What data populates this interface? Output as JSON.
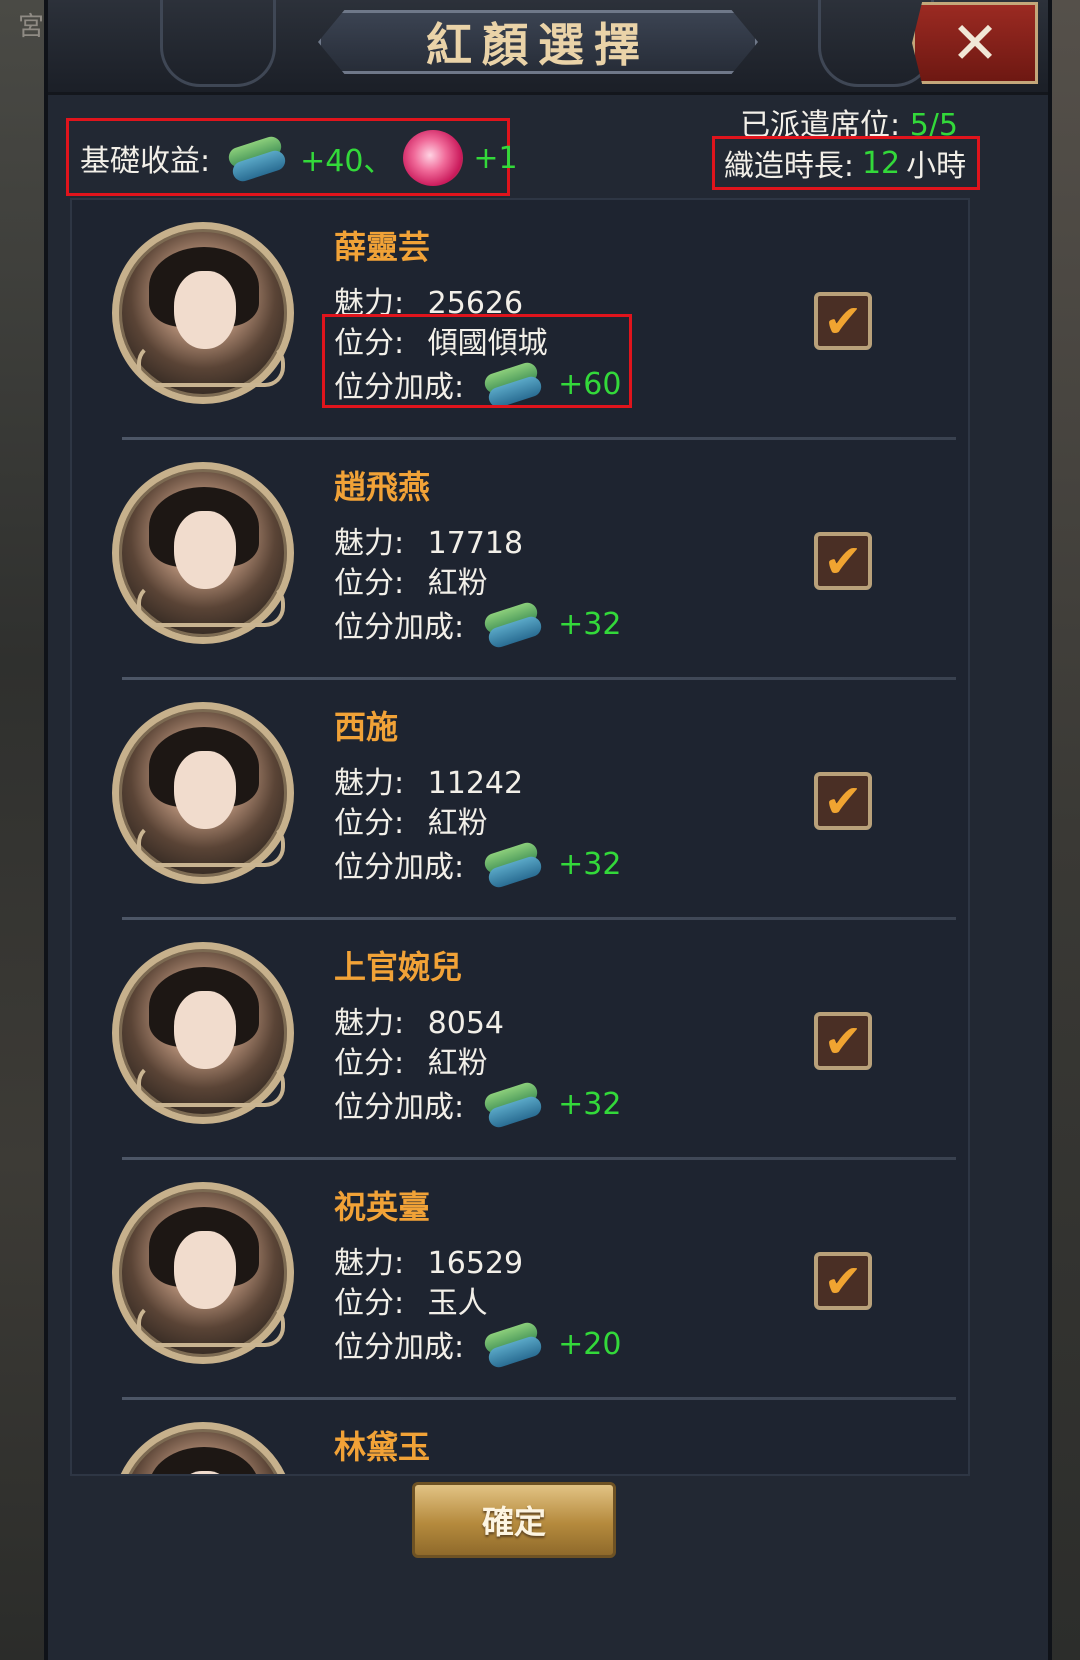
{
  "header": {
    "title": "紅顏選擇"
  },
  "background": {
    "edge_text": "宮"
  },
  "summary": {
    "base_income_label": "基礎收益:",
    "base_income_silk": "+40、",
    "base_income_flower": "+1",
    "dispatch_label": "已派遣席位:",
    "dispatch_value": "5/5",
    "duration_label": "織造時長:",
    "duration_value": "12",
    "duration_unit": "小時"
  },
  "labels": {
    "charm": "魅力:",
    "rank": "位分:",
    "rank_bonus": "位分加成:"
  },
  "consorts": [
    {
      "name": "薛靈芸",
      "charm": "25626",
      "rank": "傾國傾城",
      "bonus": "+60",
      "checked": true
    },
    {
      "name": "趙飛燕",
      "charm": "17718",
      "rank": "紅粉",
      "bonus": "+32",
      "checked": true
    },
    {
      "name": "西施",
      "charm": "11242",
      "rank": "紅粉",
      "bonus": "+32",
      "checked": true
    },
    {
      "name": "上官婉兒",
      "charm": "8054",
      "rank": "紅粉",
      "bonus": "+32",
      "checked": true
    },
    {
      "name": "祝英臺",
      "charm": "16529",
      "rank": "玉人",
      "bonus": "+20",
      "checked": true
    },
    {
      "name": "林黛玉"
    }
  ],
  "checkmark": "✔",
  "confirm_label": "確定",
  "icons": {
    "close": "close-icon",
    "silk": "silk-bolt-icon",
    "flower": "rose-icon",
    "check": "check-icon"
  },
  "colors": {
    "accent_name": "#f1a237",
    "positive_value": "#33d93a",
    "highlight_box": "#e0141c"
  }
}
